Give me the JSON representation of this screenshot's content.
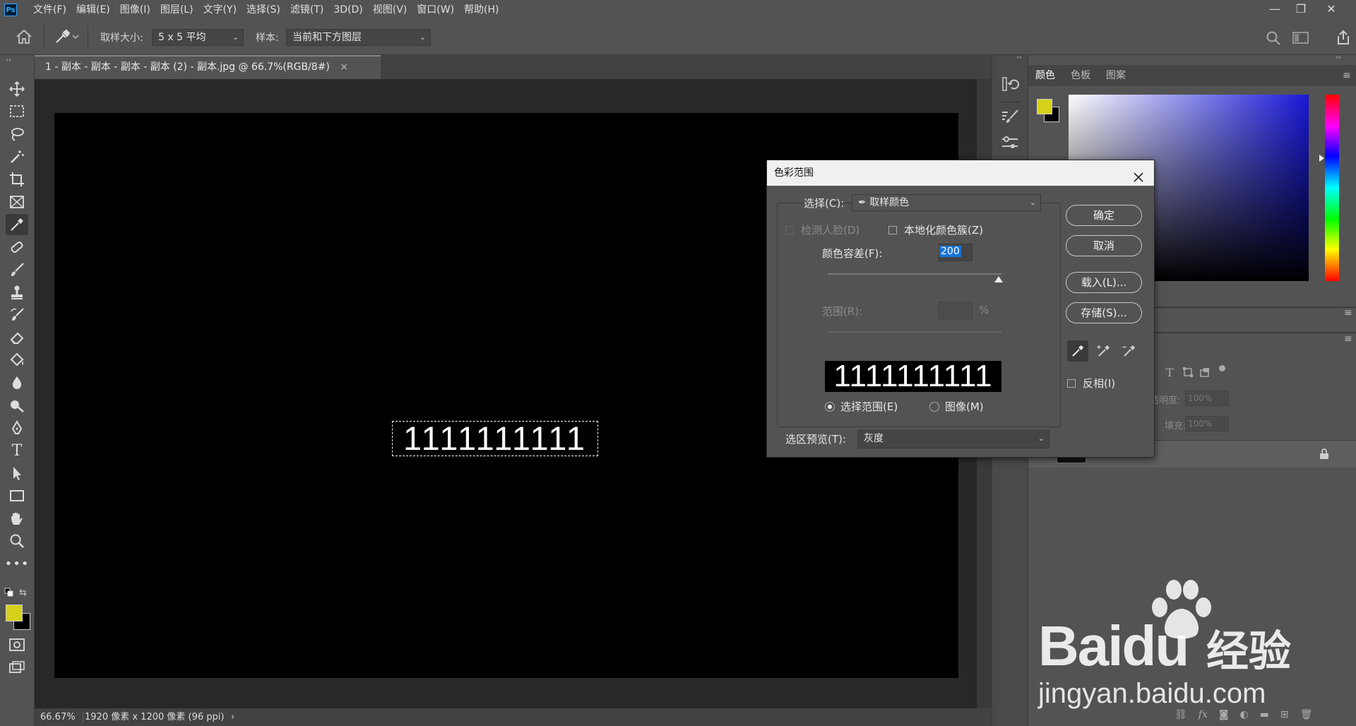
{
  "menubar": {
    "logo": "Ps",
    "items": [
      "文件(F)",
      "编辑(E)",
      "图像(I)",
      "图层(L)",
      "文字(Y)",
      "选择(S)",
      "滤镜(T)",
      "3D(D)",
      "视图(V)",
      "窗口(W)",
      "帮助(H)"
    ]
  },
  "window_controls": {
    "minimize": "—",
    "restore": "❐",
    "close": "✕"
  },
  "options": {
    "sample_size_label": "取样大小:",
    "sample_size_value": "5 x 5 平均",
    "sample_label": "样本:",
    "sample_value": "当前和下方图层"
  },
  "document": {
    "tab_title": "1 - 副本 - 副本 - 副本 - 副本 (2) - 副本.jpg @ 66.7%(RGB/8#)",
    "tab_close": "×",
    "canvas_text": "1111111111"
  },
  "status": {
    "zoom": "66.67%",
    "info": "1920 像素 x 1200 像素 (96 ppi)",
    "arrow": "›"
  },
  "right_panel": {
    "tabs": [
      "颜色",
      "色板",
      "图案"
    ],
    "fg_color": "#d6d11a",
    "bg_color": "#000000",
    "layers": {
      "opacity_label": "透明度:",
      "opacity_value": "100%",
      "fill_label": "填充:",
      "fill_value": "100%"
    }
  },
  "dialog": {
    "title": "色彩范围",
    "select_label": "选择(C):",
    "select_value": "取样颜色",
    "detect_faces": "检测人脸(D)",
    "localized": "本地化颜色簇(Z)",
    "fuzziness_label": "颜色容差(F):",
    "fuzziness_value": "200",
    "range_label": "范围(R):",
    "range_unit": "%",
    "preview_text": "1111111111",
    "radio_selection": "选择范围(E)",
    "radio_image": "图像(M)",
    "preview_label": "选区预览(T):",
    "preview_value": "灰度",
    "ok": "确定",
    "cancel": "取消",
    "load": "载入(L)...",
    "save": "存储(S)...",
    "invert": "反相(I)"
  },
  "watermark": {
    "brand": "Baidu",
    "brand_cn": "经验",
    "url": "jingyan.baidu.com"
  }
}
